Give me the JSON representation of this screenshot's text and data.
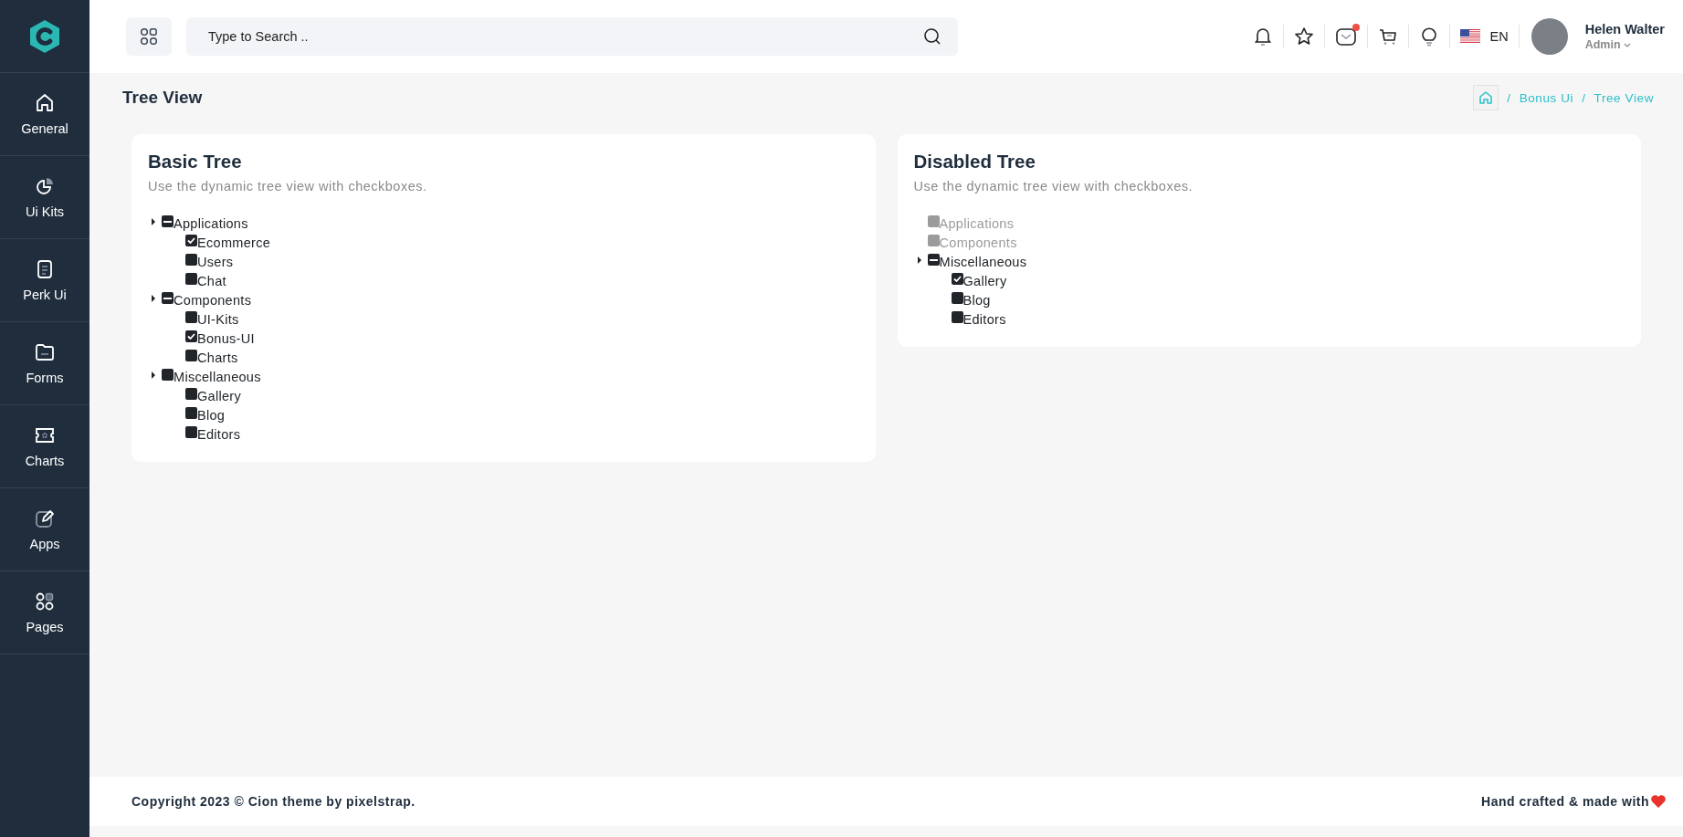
{
  "sidebar": {
    "items": [
      {
        "label": "General"
      },
      {
        "label": "Ui Kits"
      },
      {
        "label": "Perk Ui"
      },
      {
        "label": "Forms"
      },
      {
        "label": "Charts"
      },
      {
        "label": "Apps"
      },
      {
        "label": "Pages"
      }
    ]
  },
  "header": {
    "search": {
      "placeholder": "Type to Search .."
    },
    "language": "EN",
    "user": {
      "name": "Helen Walter",
      "role": "Admin"
    },
    "mail_notification": true
  },
  "page": {
    "title": "Tree View",
    "breadcrumb": {
      "separator": "/",
      "items": [
        "Bonus Ui",
        "Tree View"
      ]
    }
  },
  "cards": [
    {
      "title": "Basic Tree",
      "subtitle": "Use the dynamic tree view with checkboxes.",
      "tree": [
        {
          "label": "Applications",
          "kind": "partial",
          "disabled": false,
          "children": [
            {
              "label": "Ecommerce",
              "kind": "checked",
              "disabled": false
            },
            {
              "label": "Users",
              "kind": "unchecked",
              "disabled": false
            },
            {
              "label": "Chat",
              "kind": "unchecked",
              "disabled": false
            }
          ]
        },
        {
          "label": "Components",
          "kind": "partial",
          "disabled": false,
          "children": [
            {
              "label": "UI-Kits",
              "kind": "unchecked",
              "disabled": false
            },
            {
              "label": "Bonus-UI",
              "kind": "checked",
              "disabled": false
            },
            {
              "label": "Charts",
              "kind": "unchecked",
              "disabled": false
            }
          ]
        },
        {
          "label": "Miscellaneous",
          "kind": "unchecked",
          "disabled": false,
          "children": [
            {
              "label": "Gallery",
              "kind": "unchecked",
              "disabled": false
            },
            {
              "label": "Blog",
              "kind": "unchecked",
              "disabled": false
            },
            {
              "label": "Editors",
              "kind": "unchecked",
              "disabled": false
            }
          ]
        }
      ]
    },
    {
      "title": "Disabled Tree",
      "subtitle": "Use the dynamic tree view with checkboxes.",
      "tree": [
        {
          "label": "Applications",
          "kind": "unchecked",
          "disabled": true
        },
        {
          "label": "Components",
          "kind": "unchecked",
          "disabled": true
        },
        {
          "label": "Miscellaneous",
          "kind": "partial",
          "disabled": false,
          "children": [
            {
              "label": "Gallery",
              "kind": "checked",
              "disabled": false
            },
            {
              "label": "Blog",
              "kind": "unchecked",
              "disabled": false
            },
            {
              "label": "Editors",
              "kind": "unchecked",
              "disabled": false
            }
          ]
        }
      ]
    }
  ],
  "footer": {
    "copyright": "Copyright 2023 © Cion theme by pixelstrap.",
    "credit": "Hand crafted & made with"
  }
}
